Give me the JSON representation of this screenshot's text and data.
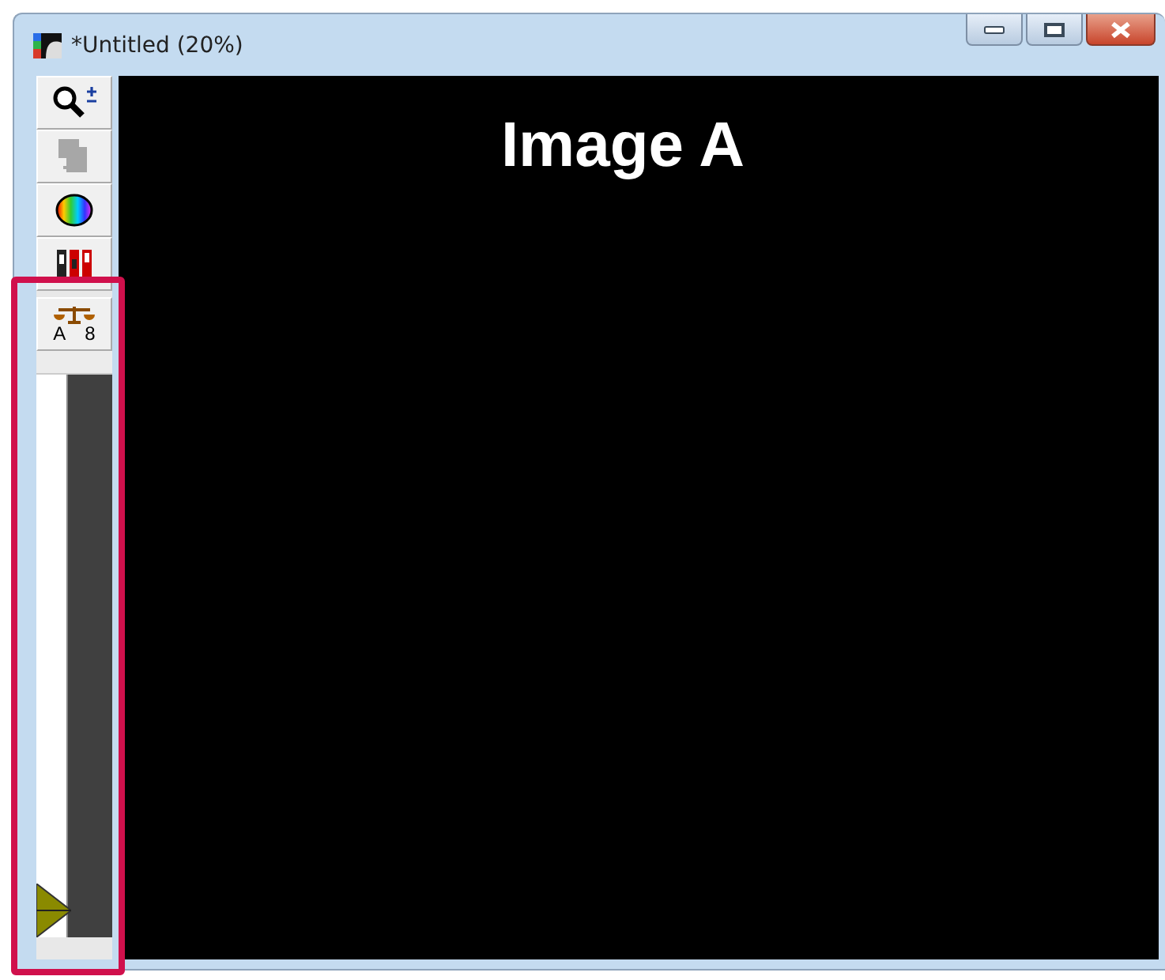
{
  "window": {
    "title": "*Untitled (20%)"
  },
  "tools": [
    {
      "kind": "zoom",
      "disabled": false
    },
    {
      "kind": "copy",
      "disabled": true
    },
    {
      "kind": "color",
      "disabled": false
    },
    {
      "kind": "channels",
      "disabled": false
    },
    {
      "kind": "balance",
      "disabled": false,
      "labels": [
        "A",
        "8"
      ]
    }
  ],
  "slider": {
    "level": 0
  },
  "canvas": {
    "caption": "Image A"
  }
}
